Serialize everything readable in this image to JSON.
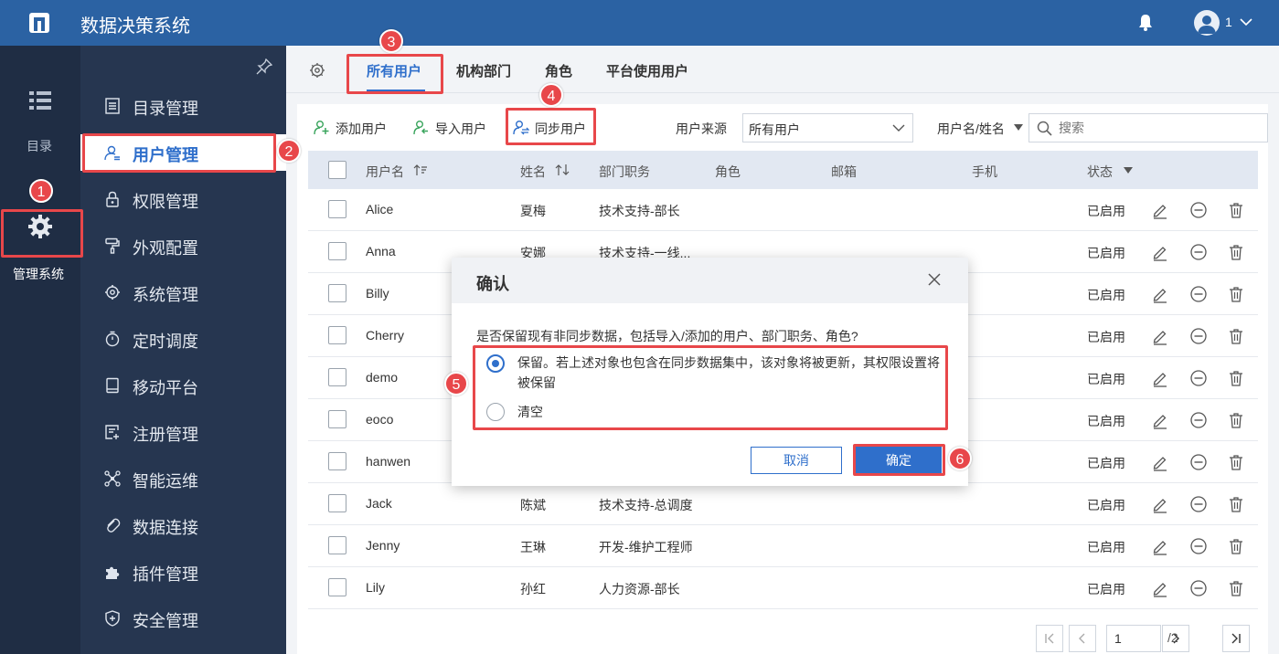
{
  "app": {
    "title": "数据决策系统",
    "user_number": "1"
  },
  "rail": {
    "catalog_label": "目录",
    "system_label": "管理系统"
  },
  "menu": {
    "items": [
      {
        "label": "目录管理",
        "icon": "catalog-icon"
      },
      {
        "label": "用户管理",
        "icon": "user-icon"
      },
      {
        "label": "权限管理",
        "icon": "lock-icon"
      },
      {
        "label": "外观配置",
        "icon": "paint-roller-icon"
      },
      {
        "label": "系统管理",
        "icon": "gear-icon"
      },
      {
        "label": "定时调度",
        "icon": "timer-icon"
      },
      {
        "label": "移动平台",
        "icon": "tablet-icon"
      },
      {
        "label": "注册管理",
        "icon": "register-icon"
      },
      {
        "label": "智能运维",
        "icon": "network-icon"
      },
      {
        "label": "数据连接",
        "icon": "link-icon"
      },
      {
        "label": "插件管理",
        "icon": "puzzle-icon"
      },
      {
        "label": "安全管理",
        "icon": "shield-icon"
      }
    ]
  },
  "tabs": [
    {
      "label": "所有用户"
    },
    {
      "label": "机构部门"
    },
    {
      "label": "角色"
    },
    {
      "label": "平台使用用户"
    }
  ],
  "toolbar": {
    "add_label": "添加用户",
    "import_label": "导入用户",
    "sync_label": "同步用户",
    "source_label": "用户来源",
    "source_value": "所有用户",
    "filter_label": "用户名/姓名",
    "search_placeholder": "搜索"
  },
  "table": {
    "headers": {
      "username": "用户名",
      "name": "姓名",
      "dept": "部门职务",
      "role": "角色",
      "email": "邮箱",
      "phone": "手机",
      "status": "状态"
    },
    "rows": [
      {
        "username": "Alice",
        "name": "夏梅",
        "dept": "技术支持-部长",
        "status": "已启用"
      },
      {
        "username": "Anna",
        "name": "安娜",
        "dept": "技术支持-一线...",
        "status": "已启用"
      },
      {
        "username": "Billy",
        "name": "",
        "dept": "",
        "status": "已启用"
      },
      {
        "username": "Cherry",
        "name": "",
        "dept": "",
        "status": "已启用"
      },
      {
        "username": "demo",
        "name": "",
        "dept": "",
        "status": "已启用"
      },
      {
        "username": "eoco",
        "name": "",
        "dept": "",
        "status": "已启用"
      },
      {
        "username": "hanwen",
        "name": "",
        "dept": "",
        "status": "已启用"
      },
      {
        "username": "Jack",
        "name": "陈斌",
        "dept": "技术支持-总调度",
        "status": "已启用"
      },
      {
        "username": "Jenny",
        "name": "王琳",
        "dept": "开发-维护工程师",
        "status": "已启用"
      },
      {
        "username": "Lily",
        "name": "孙红",
        "dept": "人力资源-部长",
        "status": "已启用"
      }
    ]
  },
  "pager": {
    "current": "1",
    "total": "/2"
  },
  "dialog": {
    "title": "确认",
    "question": "是否保留现有非同步数据，包括导入/添加的用户、部门职务、角色?",
    "option_keep": "保留。若上述对象也包含在同步数据集中，该对象将被更新，其权限设置将被保留",
    "option_clear": "清空",
    "cancel_label": "取消",
    "ok_label": "确定"
  },
  "annotations": [
    "1",
    "2",
    "3",
    "4",
    "5",
    "6"
  ],
  "colors": {
    "topbar": "#2b62a3",
    "accent": "#2f6fcb",
    "highlight": "#e8474a",
    "sidebar": "#263650",
    "rail": "#1f2d44"
  }
}
